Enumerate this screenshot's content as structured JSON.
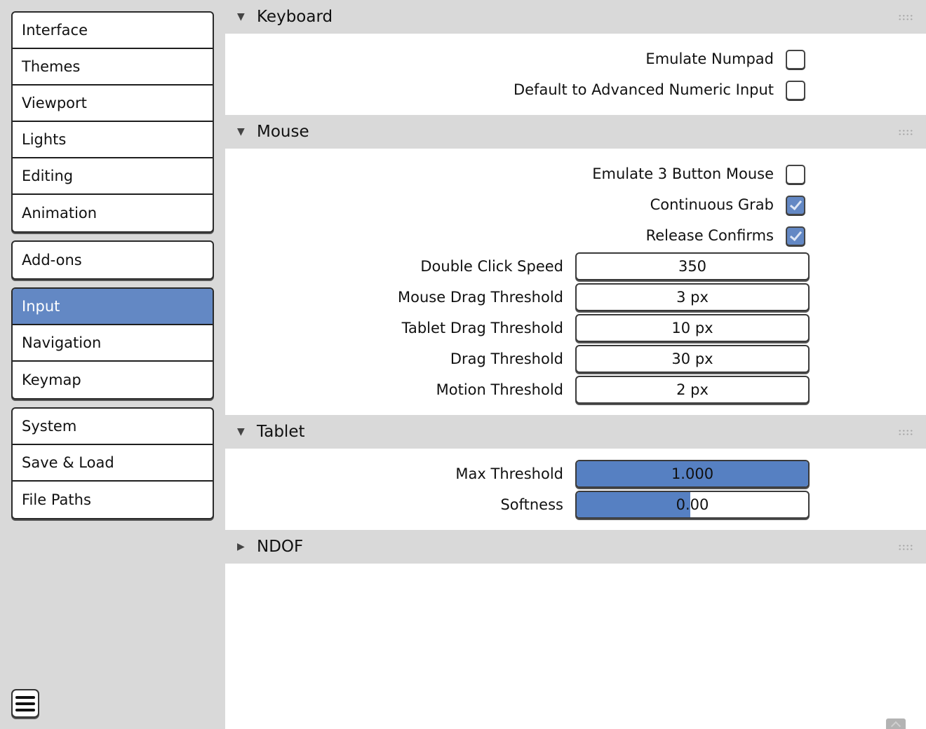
{
  "sidebar": {
    "groups": [
      {
        "items": [
          {
            "label": "Interface",
            "active": false
          },
          {
            "label": "Themes",
            "active": false
          },
          {
            "label": "Viewport",
            "active": false
          },
          {
            "label": "Lights",
            "active": false
          },
          {
            "label": "Editing",
            "active": false
          },
          {
            "label": "Animation",
            "active": false
          }
        ]
      },
      {
        "items": [
          {
            "label": "Add-ons",
            "active": false
          }
        ]
      },
      {
        "items": [
          {
            "label": "Input",
            "active": true
          },
          {
            "label": "Navigation",
            "active": false
          },
          {
            "label": "Keymap",
            "active": false
          }
        ]
      },
      {
        "items": [
          {
            "label": "System",
            "active": false
          },
          {
            "label": "Save & Load",
            "active": false
          },
          {
            "label": "File Paths",
            "active": false
          }
        ]
      }
    ],
    "menu_icon": "hamburger-menu-icon"
  },
  "accent_color": "#6388c4",
  "panels": {
    "keyboard": {
      "title": "Keyboard",
      "expanded": true,
      "emulate_numpad": {
        "label": "Emulate Numpad",
        "checked": false
      },
      "default_advanced_numeric": {
        "label": "Default to Advanced Numeric Input",
        "checked": false
      }
    },
    "mouse": {
      "title": "Mouse",
      "expanded": true,
      "emulate_3_button": {
        "label": "Emulate 3 Button Mouse",
        "checked": false
      },
      "continuous_grab": {
        "label": "Continuous Grab",
        "checked": true
      },
      "release_confirms": {
        "label": "Release Confirms",
        "checked": true
      },
      "double_click_speed": {
        "label": "Double Click Speed",
        "value": "350"
      },
      "mouse_drag_threshold": {
        "label": "Mouse Drag Threshold",
        "value": "3 px"
      },
      "tablet_drag_threshold": {
        "label": "Tablet Drag Threshold",
        "value": "10 px"
      },
      "drag_threshold": {
        "label": "Drag Threshold",
        "value": "30 px"
      },
      "motion_threshold": {
        "label": "Motion Threshold",
        "value": "2 px"
      }
    },
    "tablet": {
      "title": "Tablet",
      "expanded": true,
      "max_threshold": {
        "label": "Max Threshold",
        "value": "1.000",
        "fill_fraction": 1.0
      },
      "softness": {
        "label": "Softness",
        "value": "0.00",
        "fill_fraction": 0.49
      }
    },
    "ndof": {
      "title": "NDOF",
      "expanded": false
    }
  },
  "icons": {
    "expanded": "▼",
    "collapsed": "▶"
  }
}
